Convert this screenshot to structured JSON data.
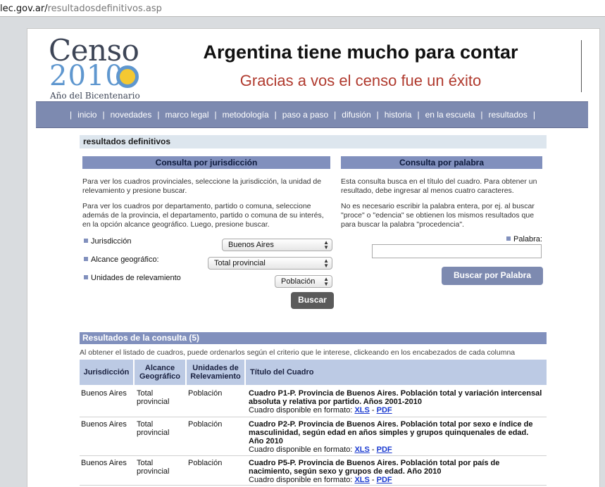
{
  "browser": {
    "url_host": "lec.gov.ar/",
    "url_path": "resultadosdefinitivos.asp"
  },
  "logo": {
    "word": "Censo",
    "year": "2010",
    "subtitle": "Año del Bicentenario"
  },
  "header": {
    "headline": "Argentina tiene mucho para contar",
    "tagline": "Gracias a vos el censo fue un éxito"
  },
  "nav": {
    "items": [
      "inicio",
      "novedades",
      "marco legal",
      "metodología",
      "paso a paso",
      "difusión",
      "historia",
      "en la escuela",
      "resultados"
    ],
    "separator": "|"
  },
  "page": {
    "section_title": "resultados definitivos"
  },
  "jurisdiccion": {
    "heading": "Consulta por jurisdicción",
    "intro1": "Para ver los cuadros provinciales, seleccione la jurisdicción, la unidad de relevamiento y presione buscar.",
    "intro2": "Para ver los cuadros por departamento, partido o comuna, seleccione además de la provincia, el departamento, partido o comuna de su interés, en la opción alcance geográfico. Luego, presione buscar.",
    "fields": {
      "jurisdiccion_label": "Jurisdicción",
      "jurisdiccion_value": "Buenos Aires",
      "alcance_label": "Alcance geográfico:",
      "alcance_value": "Total provincial",
      "unidades_label": "Unidades de relevamiento",
      "unidades_value": "Población"
    },
    "search_button": "Buscar"
  },
  "palabra": {
    "heading": "Consulta por palabra",
    "intro1": "Esta consulta busca en el título del cuadro. Para obtener un resultado, debe ingresar al menos cuatro caracteres.",
    "intro2": "No es necesario escribir la palabra entera, por ej. al buscar \"proce\" o \"edencia\" se obtienen los mismos resultados que para buscar la palabra \"procedencia\".",
    "field_label": "Palabra:",
    "field_value": "",
    "search_button": "Buscar por Palabra"
  },
  "results": {
    "bar": "Resultados de la consulta (5)",
    "note": "Al obtener el listado de cuadros, puede ordenarlos según el criterio que le interese, clickeando en los encabezados de cada columna",
    "columns": [
      "Jurisdicción",
      "Alcance Geográfico",
      "Unidades de Relevamiento",
      "Título del Cuadro"
    ],
    "rows": [
      {
        "jurisdiccion": "Buenos Aires",
        "alcance": "Total provincial",
        "unidades": "Población",
        "titulo": "Cuadro P1-P. Provincia de Buenos Aires. Población total y variación intercensal absoluta y relativa por partido. Años 2001-2010",
        "disponible": "Cuadro disponible en formato:",
        "xls": "XLS",
        "dash": "-",
        "pdf": "PDF"
      },
      {
        "jurisdiccion": "Buenos Aires",
        "alcance": "Total provincial",
        "unidades": "Población",
        "titulo": "Cuadro P2-P. Provincia de Buenos Aires. Población total por sexo e índice de masculinidad, según edad en años simples y grupos quinquenales de edad. Año 2010",
        "disponible": "Cuadro disponible en formato:",
        "xls": "XLS",
        "dash": "-",
        "pdf": "PDF"
      },
      {
        "jurisdiccion": "Buenos Aires",
        "alcance": "Total provincial",
        "unidades": "Población",
        "titulo": "Cuadro P5-P. Provincia de Buenos Aires. Población total por país de nacimiento, según sexo y grupos de edad. Año 2010",
        "disponible": "Cuadro disponible en formato:",
        "xls": "XLS",
        "dash": "-",
        "pdf": "PDF"
      }
    ]
  },
  "colors": {
    "nav": "#7d8ab0",
    "accent_red": "#b03a2e",
    "table_header": "#bccae4",
    "link": "#1a3ad0"
  }
}
